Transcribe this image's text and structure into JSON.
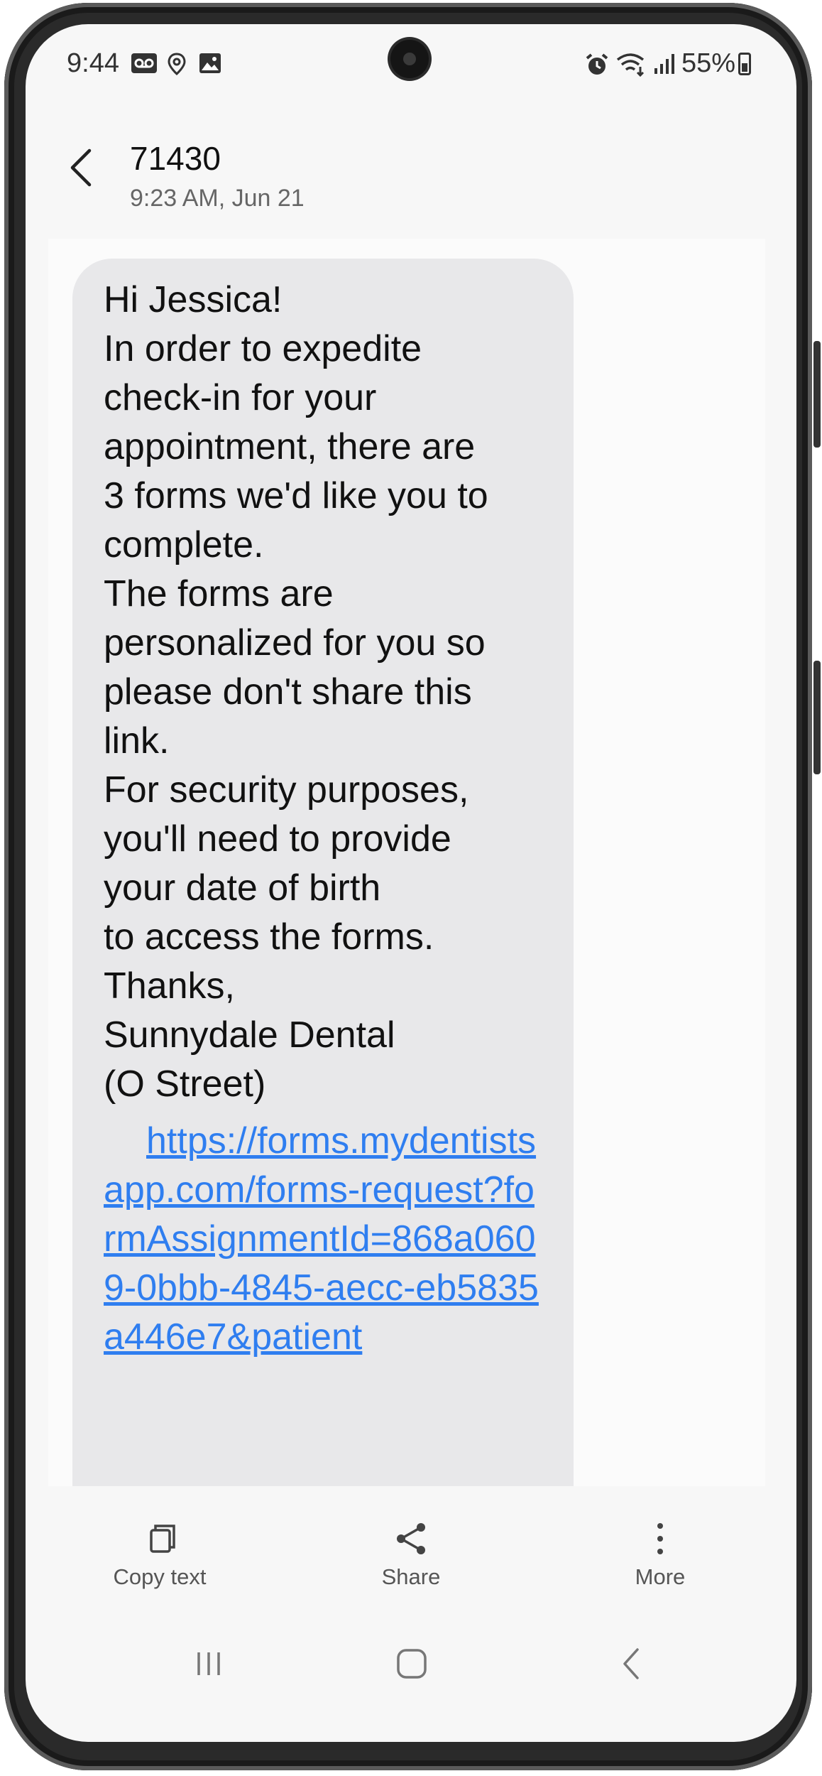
{
  "status_bar": {
    "time": "9:44",
    "battery": "55%",
    "icons": [
      "voicemail-icon",
      "location-icon",
      "gallery-icon",
      "alarm-icon",
      "wifi-icon",
      "signal-icon",
      "battery-icon"
    ]
  },
  "header": {
    "sender": "71430",
    "timestamp": "9:23 AM, Jun 21"
  },
  "message": {
    "body": "Hi Jessica!\nIn order to expedite\ncheck-in for your\nappointment, there are\n3 forms we'd like you to\ncomplete.\nThe forms are\npersonalized for you so\nplease don't share this\nlink.\nFor security purposes,\nyou'll need to provide\nyour date of birth\nto access the forms.\nThanks,\nSunnydale Dental\n(O Street)",
    "link": "https://forms.mydentistsapp.com/forms-request?formAssignmentId=868a0609-0bbb-4845-aecc-eb5835a446e7&patient"
  },
  "toolbar": {
    "copy_label": "Copy text",
    "share_label": "Share",
    "more_label": "More"
  },
  "colors": {
    "link": "#2f7ef0",
    "bubble": "#e8e8ea",
    "screen_bg": "#f7f7f7"
  }
}
